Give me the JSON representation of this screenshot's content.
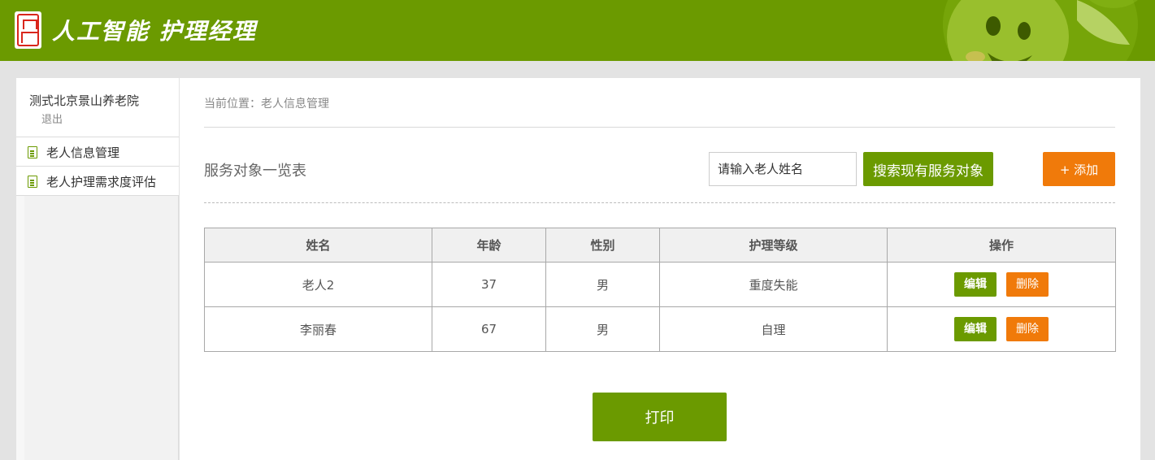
{
  "header": {
    "app_title": "人工智能 护理经理",
    "colors": {
      "brand_green": "#6b9a00",
      "accent_orange": "#f07a0a"
    }
  },
  "sidebar": {
    "org_name": "测式北京景山养老院",
    "logout_label": "退出",
    "items": [
      {
        "label": "老人信息管理",
        "icon": "document-icon"
      },
      {
        "label": "老人护理需求度评估",
        "icon": "document-icon"
      }
    ]
  },
  "main": {
    "breadcrumb": "当前位置：老人信息管理",
    "list_title": "服务对象一览表",
    "search": {
      "placeholder": "请输入老人姓名",
      "value": ""
    },
    "search_button": "搜索现有服务对象",
    "add_button": "+ 添加",
    "table": {
      "headers": [
        "姓名",
        "年龄",
        "性别",
        "护理等级",
        "操作"
      ],
      "rows": [
        {
          "name": "老人2",
          "age": "37",
          "gender": "男",
          "care_level": "重度失能",
          "edit": "编辑",
          "delete": "删除"
        },
        {
          "name": "李丽春",
          "age": "67",
          "gender": "男",
          "care_level": "自理",
          "edit": "编辑",
          "delete": "删除"
        }
      ]
    },
    "print_button": "打印"
  }
}
